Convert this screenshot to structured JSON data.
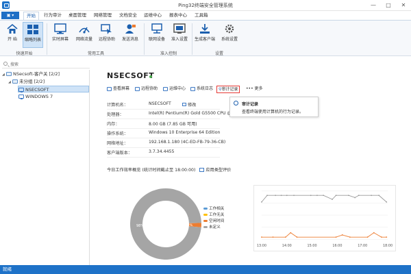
{
  "window": {
    "title": "Ping32终端安全管理系统"
  },
  "menubar": {
    "tabs": [
      "开始",
      "行为审计",
      "桌面管理",
      "网络管理",
      "文档安全",
      "运维中心",
      "报表中心",
      "工具箱"
    ],
    "active": "开始"
  },
  "ribbon": {
    "buttons": [
      "开 始",
      "缩略列表",
      "实时屏幕",
      "网络流量",
      "远程协助",
      "发送消息",
      "联网设备",
      "准入设置",
      "生成客户端",
      "系统设置"
    ],
    "groups": [
      "快速开始",
      "常用工具",
      "准入控制",
      "设置"
    ]
  },
  "search": {
    "placeholder": "搜索"
  },
  "tree": {
    "root": "NSecsoft-客户关 [2/2]",
    "group": "未分组 [2/2]",
    "hosts": [
      "NSECSOFT",
      "WINDOWS 7"
    ],
    "selected": "NSECSOFT"
  },
  "detail": {
    "host_name": "NSECSOFT",
    "toolbar": [
      "查看屏幕",
      "远程协助",
      "运维中心",
      "系统日志",
      "审计记录",
      "更多"
    ],
    "highlighted_action": "审计记录",
    "info": [
      {
        "label": "计算机名：",
        "value": "NSECSOFT",
        "extra": "修改"
      },
      {
        "label": "处理器：",
        "value": "Intel(R) Pentium(R) Gold G5500 CPU @ 3."
      },
      {
        "label": "内存：",
        "value": "8.00 GB (7.85 GB 可用)"
      },
      {
        "label": "操作系统：",
        "value": "Windows 10 Enterprise 64 Edition"
      },
      {
        "label": "网络地址：",
        "value": "192.168.1.180  (4C-ED-FB-79-36-CB)"
      },
      {
        "label": "客户端版本：",
        "value": "3.7.34.4455"
      }
    ],
    "tooltip": {
      "title": "审计记录",
      "description": "查看终端使用计算机的行为记录。"
    },
    "overview": {
      "label": "今日工作效率概览 (统计时间截止至 18:00:00)",
      "link": "应用类型评价"
    }
  },
  "donut_chart": {
    "type": "pie",
    "slices": [
      {
        "name": "工作相关",
        "value": 0,
        "color": "#5b9bd5"
      },
      {
        "name": "工作无关",
        "value": 0,
        "color": "#ffc000"
      },
      {
        "name": "空闲时间",
        "value": 2,
        "color": "#ed7d31"
      },
      {
        "name": "未定义",
        "value": 98,
        "color": "#a5a5a5"
      }
    ],
    "labels": [
      "98%",
      "2%"
    ]
  },
  "chart_data": {
    "type": "line",
    "x": [
      "13:00",
      "14:00",
      "15:00",
      "16:00",
      "17:00",
      "18:00"
    ],
    "series": [
      {
        "color": "#999999",
        "points": [
          [
            0.0,
            17
          ],
          [
            0.22,
            20
          ],
          [
            0.55,
            20
          ],
          [
            0.78,
            20
          ],
          [
            1.0,
            20
          ],
          [
            1.28,
            20
          ],
          [
            1.95,
            20
          ],
          [
            2.2,
            20
          ],
          [
            2.45,
            20
          ],
          [
            2.8,
            18.2
          ],
          [
            2.95,
            20
          ],
          [
            3.45,
            20
          ],
          [
            3.7,
            19
          ],
          [
            3.85,
            20
          ],
          [
            4.35,
            20
          ],
          [
            4.65,
            20
          ],
          [
            4.95,
            17
          ]
        ]
      },
      {
        "color": "#ed7d31",
        "points": [
          [
            0.0,
            1
          ],
          [
            0.45,
            1
          ],
          [
            0.95,
            1
          ],
          [
            1.15,
            3
          ],
          [
            1.4,
            1
          ],
          [
            2.95,
            1
          ],
          [
            3.2,
            2
          ],
          [
            3.5,
            1
          ],
          [
            4.2,
            1
          ],
          [
            4.45,
            3
          ],
          [
            4.75,
            1
          ],
          [
            4.95,
            1
          ]
        ]
      }
    ],
    "grid": true,
    "legend": "none"
  },
  "status": {
    "text": "就绪"
  },
  "colors": {
    "accent": "#1e72c8",
    "highlight": "#e53935",
    "online": "#4caf50"
  }
}
